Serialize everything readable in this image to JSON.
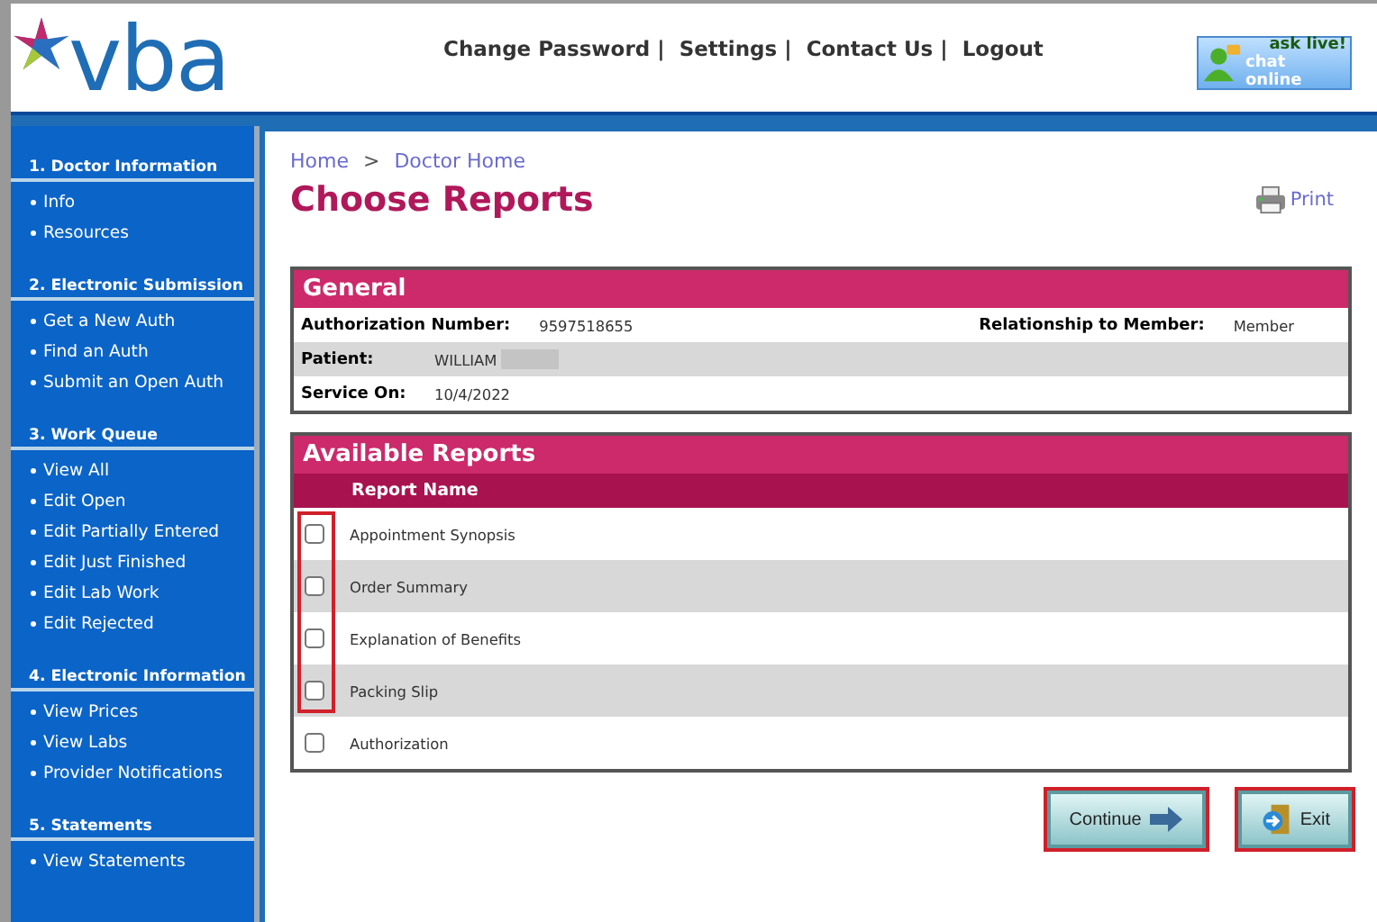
{
  "header": {
    "logo": "vba",
    "links": [
      "Change Password",
      "Settings",
      "Contact Us",
      "Logout"
    ],
    "link_separator": "|",
    "chat": {
      "line1": "ask live!",
      "line2": "chat online"
    }
  },
  "sidebar": {
    "sections": [
      {
        "title": "1. Doctor Information",
        "items": [
          "Info",
          "Resources"
        ]
      },
      {
        "title": "2. Electronic Submission",
        "items": [
          "Get a New Auth",
          "Find an Auth",
          "Submit an Open Auth"
        ]
      },
      {
        "title": "3. Work Queue",
        "items": [
          "View All",
          "Edit Open",
          "Edit Partially Entered",
          "Edit Just Finished",
          "Edit Lab Work",
          "Edit Rejected"
        ]
      },
      {
        "title": "4. Electronic Information",
        "items": [
          "View Prices",
          "View Labs",
          "Provider Notifications"
        ]
      },
      {
        "title": "5. Statements",
        "items": [
          "View Statements"
        ]
      }
    ]
  },
  "breadcrumb": [
    "Home",
    "Doctor Home"
  ],
  "breadcrumb_separator": ">",
  "page_title": "Choose Reports",
  "print_link": "Print",
  "general": {
    "title": "General",
    "rows": [
      {
        "label": "Authorization Number:",
        "value": "9597518655",
        "label_2": "Relationship to Member:",
        "value_2": "Member"
      },
      {
        "label": "Patient:",
        "value": "WILLIAM",
        "redacted": true
      },
      {
        "label": "Service On:",
        "value": "10/4/2022"
      }
    ]
  },
  "reports": {
    "title": "Available Reports",
    "column": "Report Name",
    "rows": [
      {
        "name": "Appointment Synopsis",
        "checked": false,
        "highlighted": true
      },
      {
        "name": "Order Summary",
        "checked": false,
        "highlighted": true
      },
      {
        "name": "Explanation of Benefits",
        "checked": false,
        "highlighted": true
      },
      {
        "name": "Packing Slip",
        "checked": false,
        "highlighted": true
      },
      {
        "name": "Authorization",
        "checked": false,
        "highlighted": false
      }
    ]
  },
  "buttons": [
    {
      "kind": "continue",
      "label": "Continue",
      "highlighted": true
    },
    {
      "kind": "exit",
      "label": "Exit",
      "highlighted": true
    }
  ]
}
